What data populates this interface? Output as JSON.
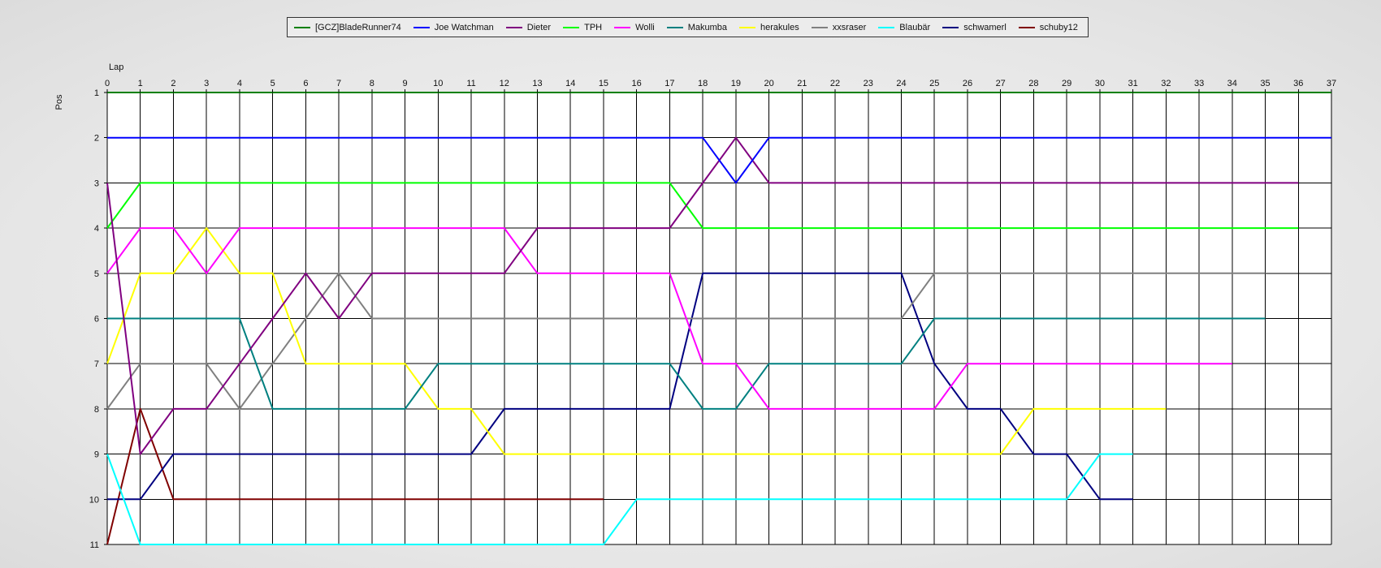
{
  "chart_data": {
    "type": "line",
    "xlabel": "Lap",
    "ylabel": "Pos",
    "xlim": [
      0,
      37
    ],
    "ylim": [
      1,
      11
    ],
    "x_ticks": [
      0,
      1,
      2,
      3,
      4,
      5,
      6,
      7,
      8,
      9,
      10,
      11,
      12,
      13,
      14,
      15,
      16,
      17,
      18,
      19,
      20,
      21,
      22,
      23,
      24,
      25,
      26,
      27,
      28,
      29,
      30,
      31,
      32,
      33,
      34,
      35,
      36,
      37
    ],
    "y_ticks": [
      1,
      2,
      3,
      4,
      5,
      6,
      7,
      8,
      9,
      10,
      11
    ],
    "y_inverted": true,
    "grid": true,
    "legend_position": "top-center",
    "series": [
      {
        "name": "[GCZ]BladeRunner74",
        "color": "#008000",
        "x": [
          0,
          37
        ],
        "y": [
          1,
          1
        ]
      },
      {
        "name": "Joe Watchman",
        "color": "#0000ff",
        "x": [
          0,
          18,
          19,
          20,
          37
        ],
        "y": [
          2,
          2,
          3,
          2,
          2
        ]
      },
      {
        "name": "Dieter",
        "color": "#800080",
        "x": [
          0,
          1,
          2,
          3,
          4,
          5,
          6,
          7,
          8,
          12,
          13,
          17,
          18,
          19,
          20,
          36
        ],
        "y": [
          3,
          9,
          8,
          8,
          7,
          6,
          5,
          6,
          5,
          5,
          4,
          4,
          3,
          2,
          3,
          3
        ]
      },
      {
        "name": "TPH",
        "color": "#00ff00",
        "x": [
          0,
          1,
          17,
          18,
          36
        ],
        "y": [
          4,
          3,
          3,
          4,
          4
        ]
      },
      {
        "name": "Wolli",
        "color": "#ff00ff",
        "x": [
          0,
          1,
          2,
          3,
          4,
          12,
          13,
          17,
          18,
          19,
          20,
          25,
          26,
          34
        ],
        "y": [
          5,
          4,
          4,
          5,
          4,
          4,
          5,
          5,
          7,
          7,
          8,
          8,
          7,
          7
        ]
      },
      {
        "name": "Makumba",
        "color": "#008080",
        "x": [
          0,
          4,
          5,
          9,
          10,
          17,
          18,
          19,
          20,
          24,
          25,
          35
        ],
        "y": [
          6,
          6,
          8,
          8,
          7,
          7,
          8,
          8,
          7,
          7,
          6,
          6
        ]
      },
      {
        "name": "herakules",
        "color": "#ffff00",
        "x": [
          0,
          1,
          2,
          3,
          4,
          5,
          6,
          9,
          10,
          11,
          12,
          27,
          28,
          32
        ],
        "y": [
          7,
          5,
          5,
          4,
          5,
          5,
          7,
          7,
          8,
          8,
          9,
          9,
          8,
          8
        ]
      },
      {
        "name": "xxsraser",
        "color": "#808080",
        "x": [
          0,
          1,
          3,
          4,
          5,
          6,
          7,
          8,
          24,
          25,
          35
        ],
        "y": [
          8,
          7,
          7,
          8,
          7,
          6,
          5,
          6,
          6,
          5,
          5
        ]
      },
      {
        "name": "Blaubär",
        "color": "#00ffff",
        "x": [
          0,
          1,
          15,
          16,
          29,
          30,
          31
        ],
        "y": [
          9,
          11,
          11,
          10,
          10,
          9,
          9
        ]
      },
      {
        "name": "schwamerl",
        "color": "#000080",
        "x": [
          0,
          1,
          2,
          11,
          12,
          17,
          18,
          24,
          25,
          26,
          27,
          28,
          29,
          30,
          31
        ],
        "y": [
          10,
          10,
          9,
          9,
          8,
          8,
          5,
          5,
          7,
          8,
          8,
          9,
          9,
          10,
          10
        ]
      },
      {
        "name": "schuby12",
        "color": "#800000",
        "x": [
          0,
          1,
          2,
          15
        ],
        "y": [
          11,
          8,
          10,
          10
        ]
      }
    ]
  }
}
